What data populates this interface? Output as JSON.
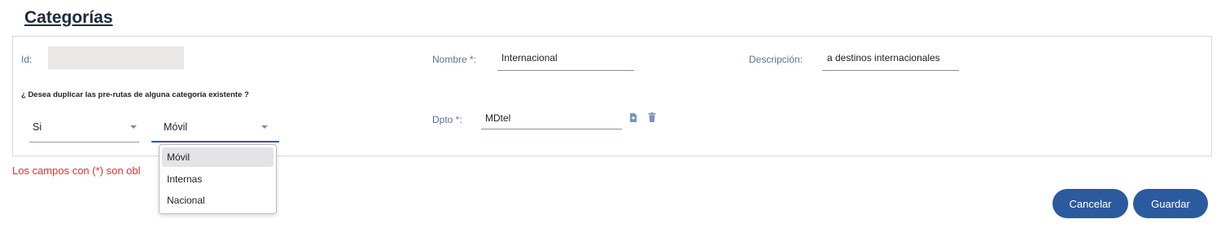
{
  "page_title": "Categorías",
  "form": {
    "id_label": "Id:",
    "id_value": "",
    "nombre_label": "Nombre *:",
    "nombre_value": "Internacional",
    "descripcion_label": "Descripción:",
    "descripcion_value": "a destinos internacionales",
    "duplicate_question": "¿ Desea duplicar las pre-rutas de alguna categoría existente ?",
    "duplicate_select_value": "Si",
    "category_select_value": "Móvil",
    "dpto_label": "Dpto *:",
    "dpto_value": "MDtel"
  },
  "icons": {
    "add": "file-add-icon",
    "delete": "trash-icon"
  },
  "dropdown": {
    "options": [
      "Móvil",
      "Internas",
      "Nacional"
    ],
    "selected": "Móvil"
  },
  "required_note": "Los campos con (*) son obl",
  "buttons": {
    "cancel": "Cancelar",
    "save": "Guardar"
  },
  "colors": {
    "accent": "#2c5a9e",
    "label": "#5b6f9a",
    "error": "#e0302e",
    "select_underline": "#3a4fb5"
  }
}
